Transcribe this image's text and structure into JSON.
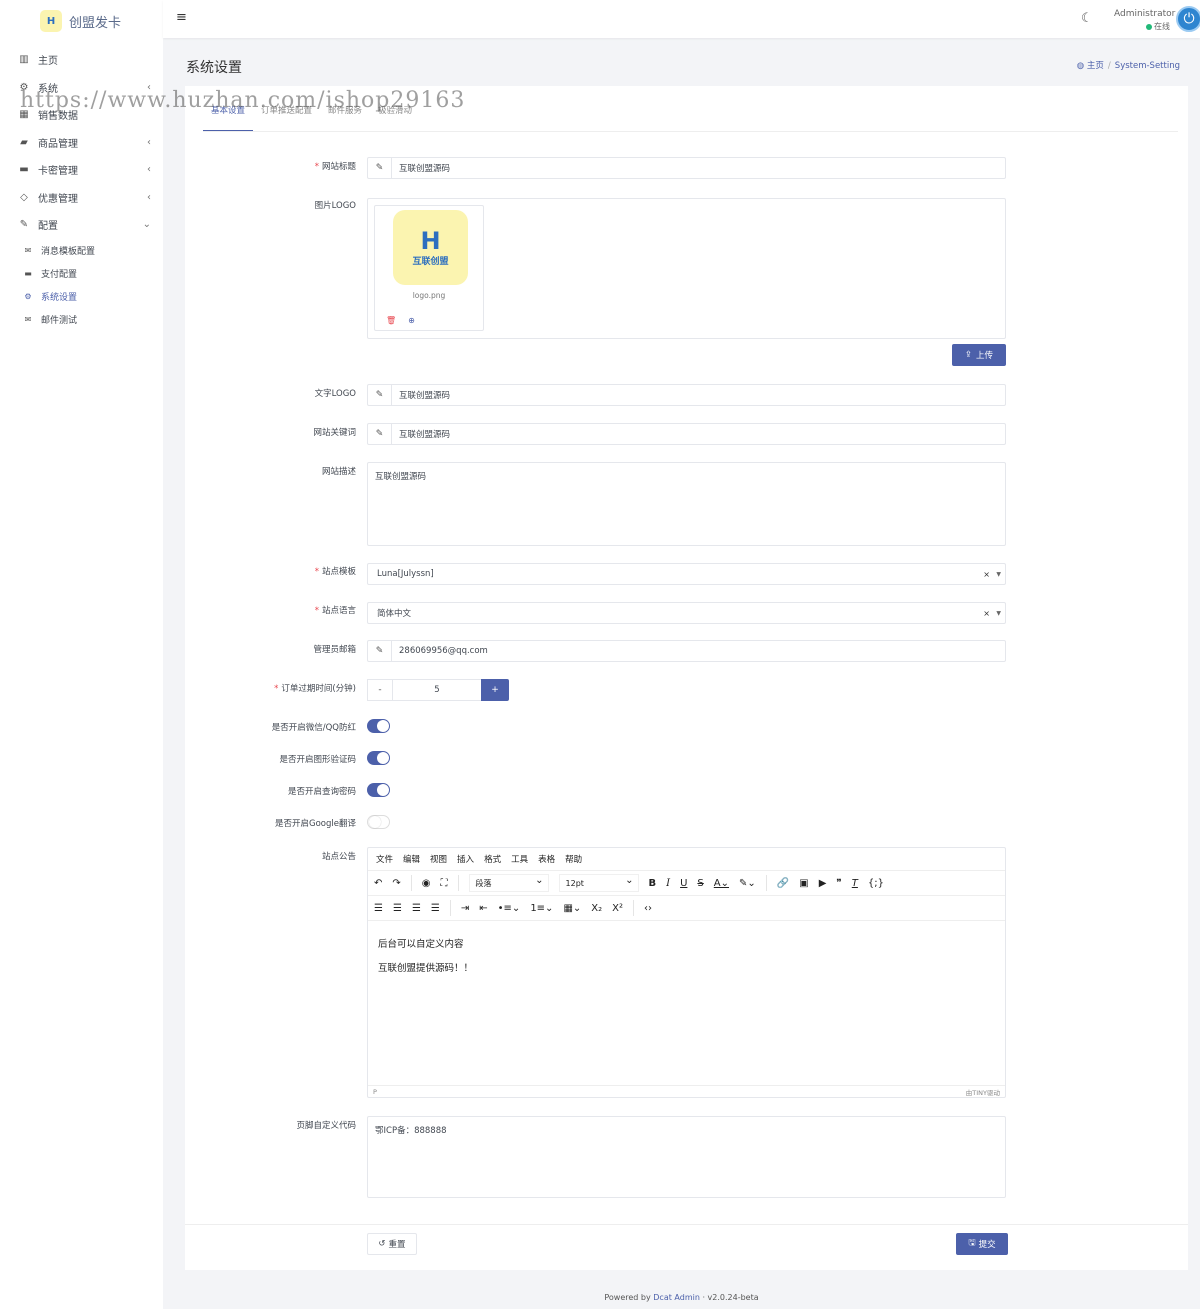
{
  "brand": {
    "logo_text": "互联创盟",
    "name": "创盟发卡"
  },
  "nav": {
    "home": "主页",
    "system": "系统",
    "sales": "销售数据",
    "products": "商品管理",
    "cards": "卡密管理",
    "coupons": "优惠管理",
    "config": "配置",
    "sub": [
      "消息模板配置",
      "支付配置",
      "系统设置",
      "邮件测试"
    ]
  },
  "topbar": {
    "user": "Administrator",
    "status": "在线"
  },
  "page": {
    "title": "系统设置",
    "breadcrumb_home": "主页",
    "breadcrumb_current": "System-Setting"
  },
  "tabs": [
    "基本设置",
    "订单推送配置",
    "邮件服务",
    "极验滑动"
  ],
  "form": {
    "site_title_label": "网站标题",
    "site_title": "互联创盟源码",
    "img_logo_label": "图片LOGO",
    "logo_file": "logo.png",
    "upload_label": "上传",
    "text_logo_label": "文字LOGO",
    "text_logo": "互联创盟源码",
    "keywords_label": "网站关键词",
    "keywords": "互联创盟源码",
    "description_label": "网站描述",
    "description": "互联创盟源码",
    "template_label": "站点模板",
    "template": "Luna[Julyssn]",
    "language_label": "站点语言",
    "language": "简体中文",
    "email_label": "管理员邮箱",
    "email": "286069956@qq.com",
    "expire_label": "订单过期时间(分钟)",
    "expire": "5",
    "minus": "-",
    "plus": "+",
    "toggle1_label": "是否开启微信/QQ防红",
    "toggle2_label": "是否开启图形验证码",
    "toggle3_label": "是否开启查询密码",
    "toggle4_label": "是否开启Google翻译",
    "toggles": [
      true,
      true,
      true,
      false
    ],
    "notice_label": "站点公告",
    "editor_menu": [
      "文件",
      "编辑",
      "视图",
      "插入",
      "格式",
      "工具",
      "表格",
      "帮助"
    ],
    "editor_block": "段落",
    "editor_size": "12pt",
    "notice_line1": "后台可以自定义内容",
    "notice_line2": "互联创盟提供源码！！",
    "editor_path": "P",
    "editor_brand": "由TINY驱动",
    "footer_code_label": "页脚自定义代码",
    "footer_code": "鄂ICP备：888888",
    "reset": "重置",
    "submit": "提交"
  },
  "footer": {
    "prefix": "Powered by ",
    "link": "Dcat Admin",
    "version": " · v2.0.24-beta"
  },
  "watermark": "https://www.huzhan.com/ishop29163",
  "colors": {
    "primary": "#4c60aa",
    "success": "#21b978",
    "danger": "#e8474f"
  }
}
